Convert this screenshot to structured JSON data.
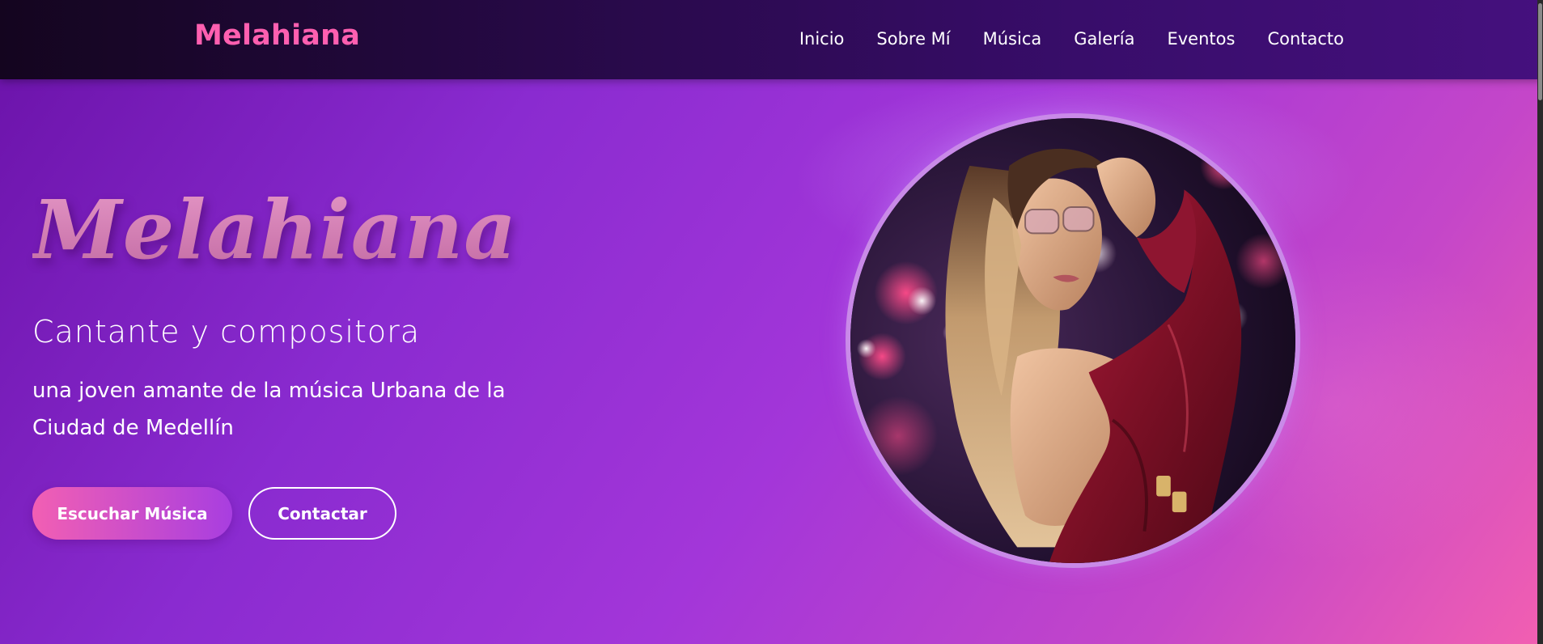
{
  "nav": {
    "brand": "Melahiana",
    "links": [
      {
        "label": "Inicio"
      },
      {
        "label": "Sobre Mí"
      },
      {
        "label": "Música"
      },
      {
        "label": "Galería"
      },
      {
        "label": "Eventos"
      },
      {
        "label": "Contacto"
      }
    ]
  },
  "hero": {
    "title": "Melahiana",
    "subtitle": "Cantante y compositora",
    "description": "una joven amante de la música Urbana de la Ciudad de Medellín",
    "primary_button": "Escuchar Música",
    "secondary_button": "Contactar"
  },
  "colors": {
    "brand": "#ff5fb0",
    "accent_purple": "#a336d9",
    "accent_pink": "#f25fb1",
    "portrait_border": "#c98ae8"
  }
}
